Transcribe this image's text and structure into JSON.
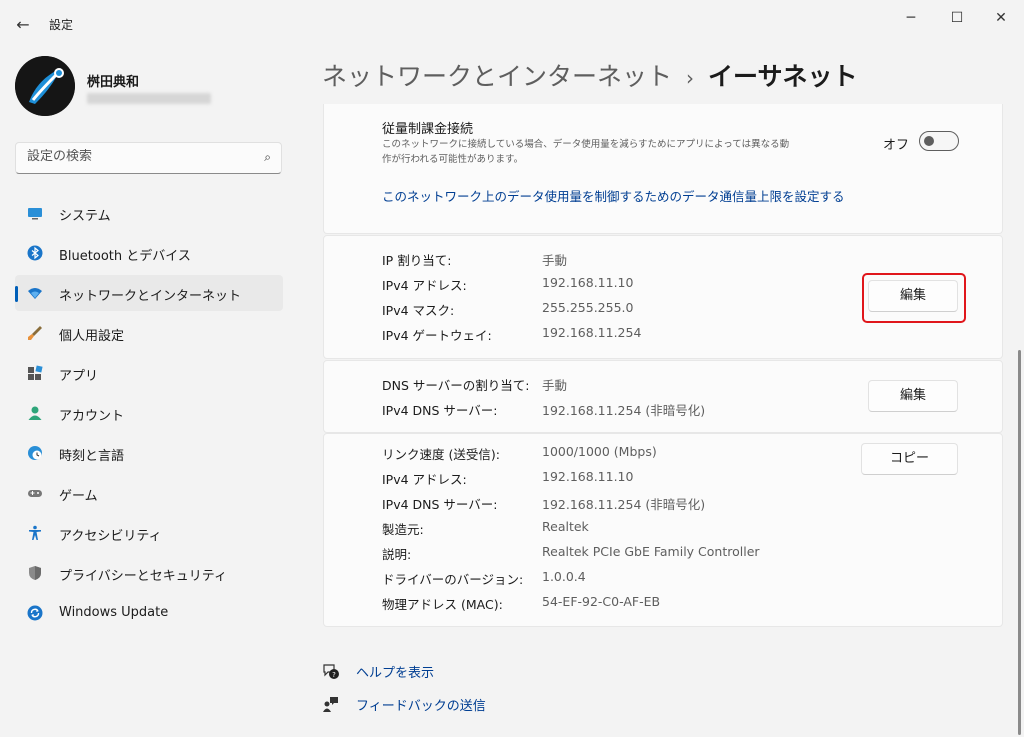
{
  "window": {
    "title": "設定",
    "back_icon": "←",
    "minimize_icon": "─",
    "maximize_icon": "☐",
    "close_icon": "✕"
  },
  "user": {
    "name": "桝田典和"
  },
  "search": {
    "placeholder": "設定の検索",
    "icon": "⌕"
  },
  "sidebar": {
    "items": [
      {
        "label": "システム",
        "icon": "monitor-icon"
      },
      {
        "label": "Bluetooth とデバイス",
        "icon": "bluetooth-icon"
      },
      {
        "label": "ネットワークとインターネット",
        "icon": "wifi-icon",
        "selected": true
      },
      {
        "label": "個人用設定",
        "icon": "brush-icon"
      },
      {
        "label": "アプリ",
        "icon": "apps-icon"
      },
      {
        "label": "アカウント",
        "icon": "account-icon"
      },
      {
        "label": "時刻と言語",
        "icon": "globe-clock-icon"
      },
      {
        "label": "ゲーム",
        "icon": "gamepad-icon"
      },
      {
        "label": "アクセシビリティ",
        "icon": "accessibility-icon"
      },
      {
        "label": "プライバシーとセキュリティ",
        "icon": "shield-icon"
      },
      {
        "label": "Windows Update",
        "icon": "update-icon"
      }
    ]
  },
  "breadcrumb": {
    "parent": "ネットワークとインターネット",
    "separator": "›",
    "current": "イーサネット"
  },
  "metered": {
    "title": "従量制課金接続",
    "description": "このネットワークに接続している場合、データ使用量を減らすためにアプリによっては異なる動作が行われる可能性があります。",
    "toggle_label": "オフ",
    "toggle_on": false,
    "data_limit_link": "このネットワーク上のデータ使用量を制御するためのデータ通信量上限を設定する"
  },
  "ip": {
    "rows": [
      {
        "key": "IP 割り当て:",
        "value": "手動"
      },
      {
        "key": "IPv4 アドレス:",
        "value": "192.168.11.10"
      },
      {
        "key": "IPv4 マスク:",
        "value": "255.255.255.0"
      },
      {
        "key": "IPv4 ゲートウェイ:",
        "value": "192.168.11.254"
      }
    ],
    "edit_label": "編集"
  },
  "dns": {
    "rows": [
      {
        "key": "DNS サーバーの割り当て:",
        "value": "手動"
      },
      {
        "key": "IPv4 DNS サーバー:",
        "value": "192.168.11.254 (非暗号化)"
      }
    ],
    "edit_label": "編集"
  },
  "properties": {
    "copy_label": "コピー",
    "rows": [
      {
        "key": "リンク速度 (送受信):",
        "value": "1000/1000 (Mbps)"
      },
      {
        "key": "IPv4 アドレス:",
        "value": "192.168.11.10"
      },
      {
        "key": "IPv4 DNS サーバー:",
        "value": "192.168.11.254 (非暗号化)"
      },
      {
        "key": "製造元:",
        "value": "Realtek"
      },
      {
        "key": "説明:",
        "value": "Realtek PCIe GbE Family Controller"
      },
      {
        "key": "ドライバーのバージョン:",
        "value": "1.0.0.4"
      },
      {
        "key": "物理アドレス (MAC):",
        "value": "54-EF-92-C0-AF-EB"
      }
    ]
  },
  "footer": {
    "help": {
      "label": "ヘルプを表示",
      "icon": "help-icon"
    },
    "feedback": {
      "label": "フィードバックの送信",
      "icon": "feedback-icon"
    }
  },
  "colors": {
    "accent": "#005fb8",
    "link": "#003e92",
    "highlight": "#e0161b"
  }
}
